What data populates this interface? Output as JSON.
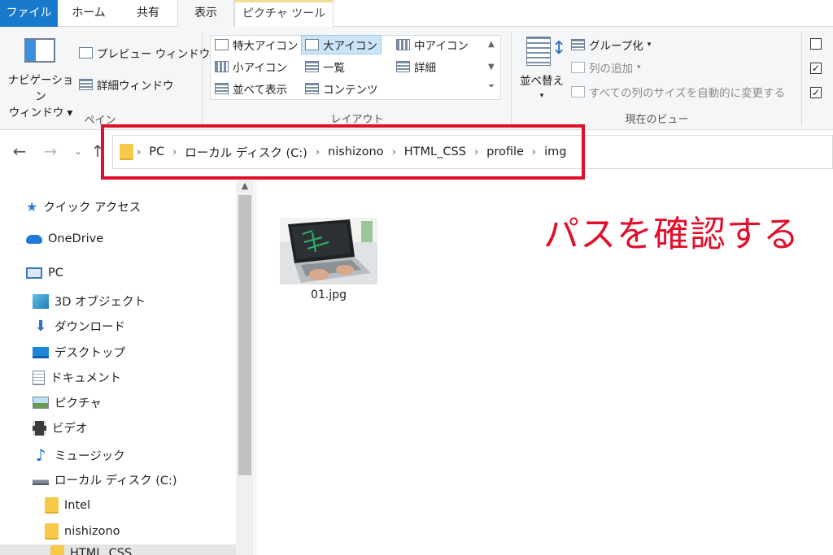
{
  "tabs": [
    {
      "label": "ファイル"
    },
    {
      "label": "ホーム"
    },
    {
      "label": "共有"
    },
    {
      "label": "表示"
    },
    {
      "label": "ピクチャ ツール"
    }
  ],
  "ribbon": {
    "pane": {
      "nav_pane_line1": "ナビゲーション",
      "nav_pane_line2": "ウィンドウ",
      "preview_window": "プレビュー ウィンドウ",
      "details_window": "詳細ウィンドウ",
      "group_label": "ペイン"
    },
    "layout": {
      "items": [
        "特大アイコン",
        "大アイコン",
        "中アイコン",
        "小アイコン",
        "一覧",
        "詳細",
        "並べて表示",
        "コンテンツ"
      ],
      "group_label": "レイアウト"
    },
    "current_view": {
      "sort_by": "並べ替え",
      "group_by": "グループ化",
      "add_columns": "列の追加",
      "size_all_columns": "すべての列のサイズを自動的に変更する",
      "group_label": "現在のビュー"
    }
  },
  "address": {
    "crumbs": [
      "PC",
      "ローカル ディスク (C:)",
      "nishizono",
      "HTML_CSS",
      "profile",
      "img"
    ]
  },
  "navpane": {
    "quick_access": "クイック アクセス",
    "onedrive": "OneDrive",
    "pc": "PC",
    "objects3d": "3D オブジェクト",
    "downloads": "ダウンロード",
    "desktop": "デスクトップ",
    "documents": "ドキュメント",
    "pictures": "ピクチャ",
    "videos": "ビデオ",
    "music": "ミュージック",
    "local_disk": "ローカル ディスク (C:)",
    "intel": "Intel",
    "nishizono": "nishizono",
    "html_css": "HTML_CSS"
  },
  "content": {
    "file_name": "01.jpg"
  },
  "annotation": "パスを確認する",
  "colors": {
    "accent": "#1979ca",
    "annotation": "#e0102b",
    "folder": "#f6c948"
  }
}
